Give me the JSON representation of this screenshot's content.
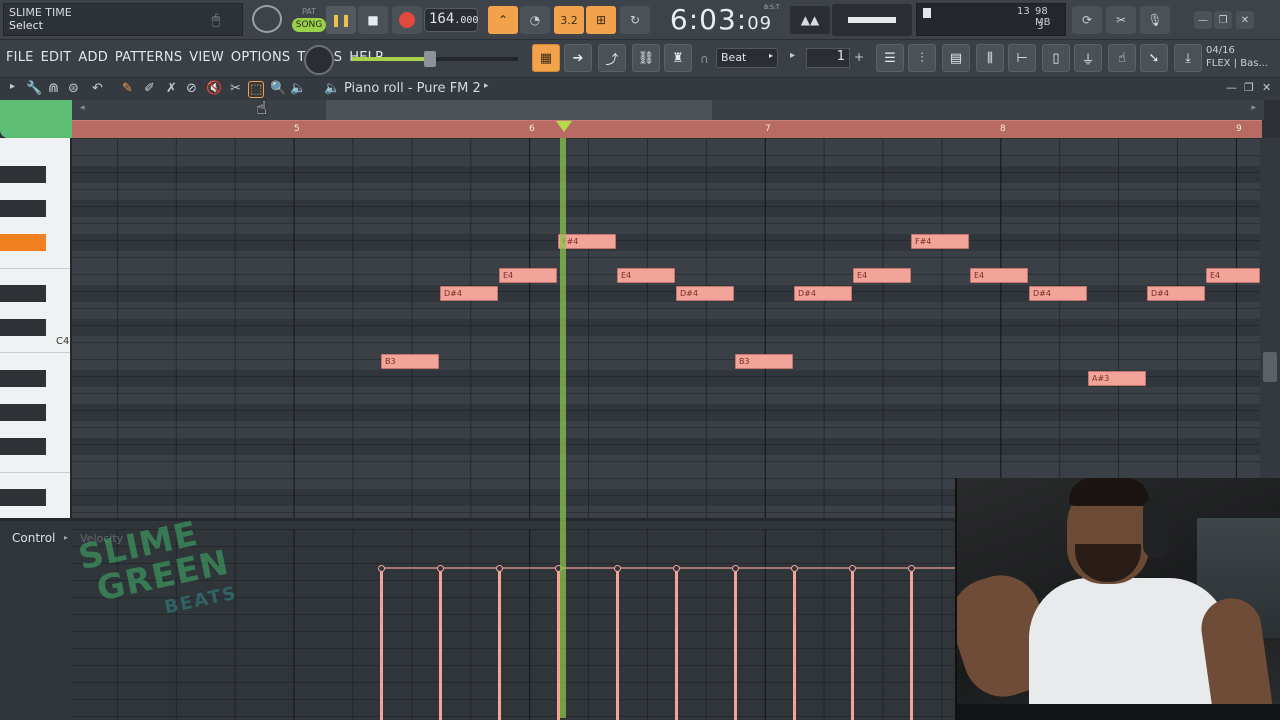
{
  "hint": {
    "line1": "SLIME TIME",
    "line2": "Select"
  },
  "transport": {
    "song_label": "SONG",
    "pat_label": "PAT",
    "bpm": "164",
    "bpm_decimal": ".000",
    "time_main": "6:03:",
    "time_sub": "09",
    "time_unit": "B:S:T",
    "pattern_step_label": "3.2",
    "cpu_voices": "13",
    "mem": "98 MB",
    "voices_count": "3"
  },
  "menu": {
    "items": [
      "FILE",
      "EDIT",
      "ADD",
      "PATTERNS",
      "VIEW",
      "OPTIONS",
      "TOOLS",
      "HELP"
    ]
  },
  "snap": {
    "value": "Beat"
  },
  "pattern": {
    "number": "1"
  },
  "flex": {
    "line1": "04/16",
    "line2": "FLEX | Bas..."
  },
  "piano_roll": {
    "title": "Piano roll - Pure FM 2"
  },
  "ruler": {
    "bars": [
      "5",
      "6",
      "7",
      "8",
      "9"
    ]
  },
  "keyboard": {
    "c_label": "C4"
  },
  "notes": [
    {
      "label": "B3"
    },
    {
      "label": "D#4"
    },
    {
      "label": "E4"
    },
    {
      "label": "F#4"
    },
    {
      "label": "E4"
    },
    {
      "label": "D#4"
    },
    {
      "label": "B3"
    },
    {
      "label": "D#4"
    },
    {
      "label": "E4"
    },
    {
      "label": "F#4"
    },
    {
      "label": "E4"
    },
    {
      "label": "D#4"
    },
    {
      "label": "A#3"
    },
    {
      "label": "D#4"
    },
    {
      "label": "E4"
    }
  ],
  "control": {
    "label": "Control",
    "lane": "Velocity"
  },
  "watermark": {
    "line1": "SLIME",
    "line2": "GREEN",
    "line3": "BEATS"
  },
  "colors": {
    "note": "#f2a49b",
    "playhead": "#8bc34a",
    "ruler": "#b86b63",
    "accent": "#f2a24a"
  }
}
